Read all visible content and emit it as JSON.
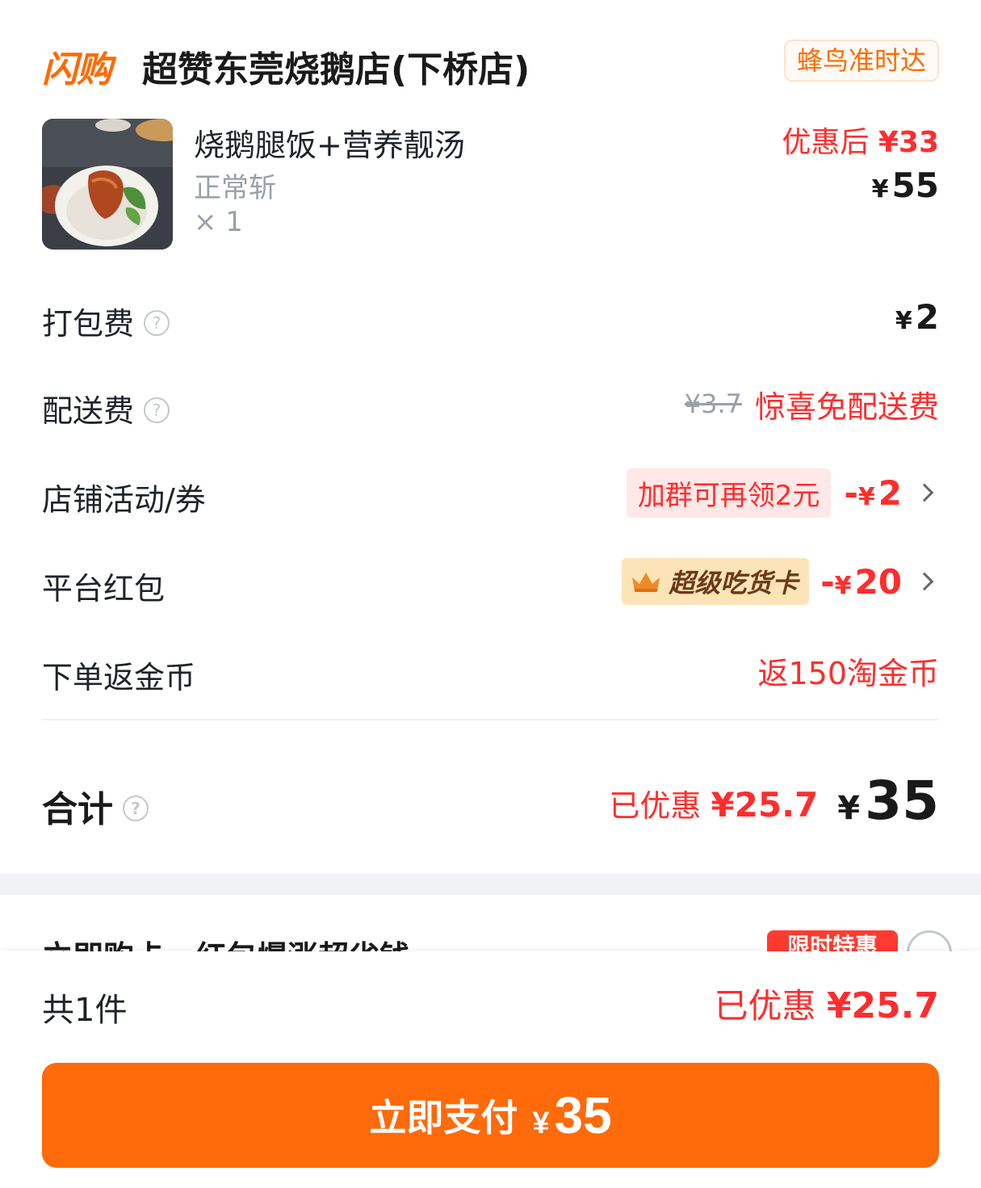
{
  "header": {
    "brand": "闪购",
    "shop_name": "超赞东莞烧鹅店(下桥店)",
    "delivery_badge": "蜂鸟准时达"
  },
  "item": {
    "name": "烧鹅腿饭+营养靓汤",
    "spec": "正常斩",
    "qty": "× 1",
    "after_label": "优惠后",
    "after_price": "33",
    "price": "55"
  },
  "currency": "¥",
  "fees": {
    "packing": {
      "label": "打包费",
      "amount": "2"
    },
    "delivery": {
      "label": "配送费",
      "original": "¥3.7",
      "promo": "惊喜免配送费"
    },
    "shop_coupon": {
      "label": "店铺活动/券",
      "tag": "加群可再领2元",
      "sign": "-",
      "amount": "2"
    },
    "platform": {
      "label": "平台红包",
      "tag": "超级吃货卡",
      "sign": "-",
      "amount": "20"
    },
    "coins": {
      "label": "下单返金币",
      "value": "返150淘金币"
    }
  },
  "total": {
    "label": "合计",
    "saved_label": "已优惠",
    "saved_amount": "25.7",
    "amount": "35"
  },
  "promo": {
    "text": "立即购卡，红包爆涨超省钱",
    "tag": "限时特惠"
  },
  "bottom": {
    "count": "共1件",
    "saved_label": "已优惠",
    "saved_amount": "25.7",
    "pay_label": "立即支付",
    "pay_amount": "35"
  },
  "colors": {
    "accent": "#ff6a0a",
    "discount_red": "#ff2d2d",
    "vip_gold": "#fde4b8"
  }
}
